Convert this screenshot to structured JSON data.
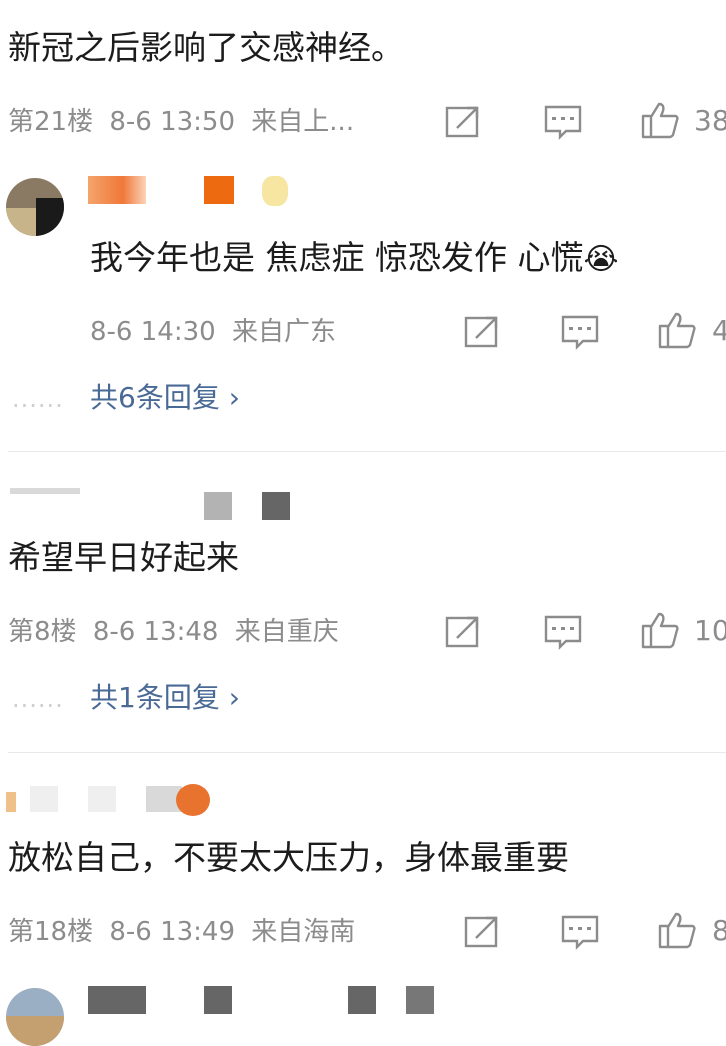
{
  "comments": [
    {
      "text": "新冠之后影响了交感神经。",
      "floor": "第21楼",
      "time": "8-6 13:50",
      "location": "来自上...",
      "likes": "38"
    },
    {
      "text": "我今年也是 焦虑症 惊恐发作 心慌",
      "emoji": "😭",
      "time": "8-6 14:30",
      "location": "来自广东",
      "likes": "4",
      "replies": "共6条回复 ›"
    },
    {
      "text": "希望早日好起来",
      "floor": "第8楼",
      "time": "8-6 13:48",
      "location": "来自重庆",
      "likes": "10",
      "replies": "共1条回复 ›"
    },
    {
      "text": "放松自己，不要太大压力，身体最重要",
      "floor": "第18楼",
      "time": "8-6 13:49",
      "location": "来自海南",
      "likes": "8"
    }
  ],
  "dots": "......",
  "colors": {
    "reply_link": "#4a6a96",
    "meta_gray": "#8c8c8c",
    "text": "#1c1c1c"
  }
}
